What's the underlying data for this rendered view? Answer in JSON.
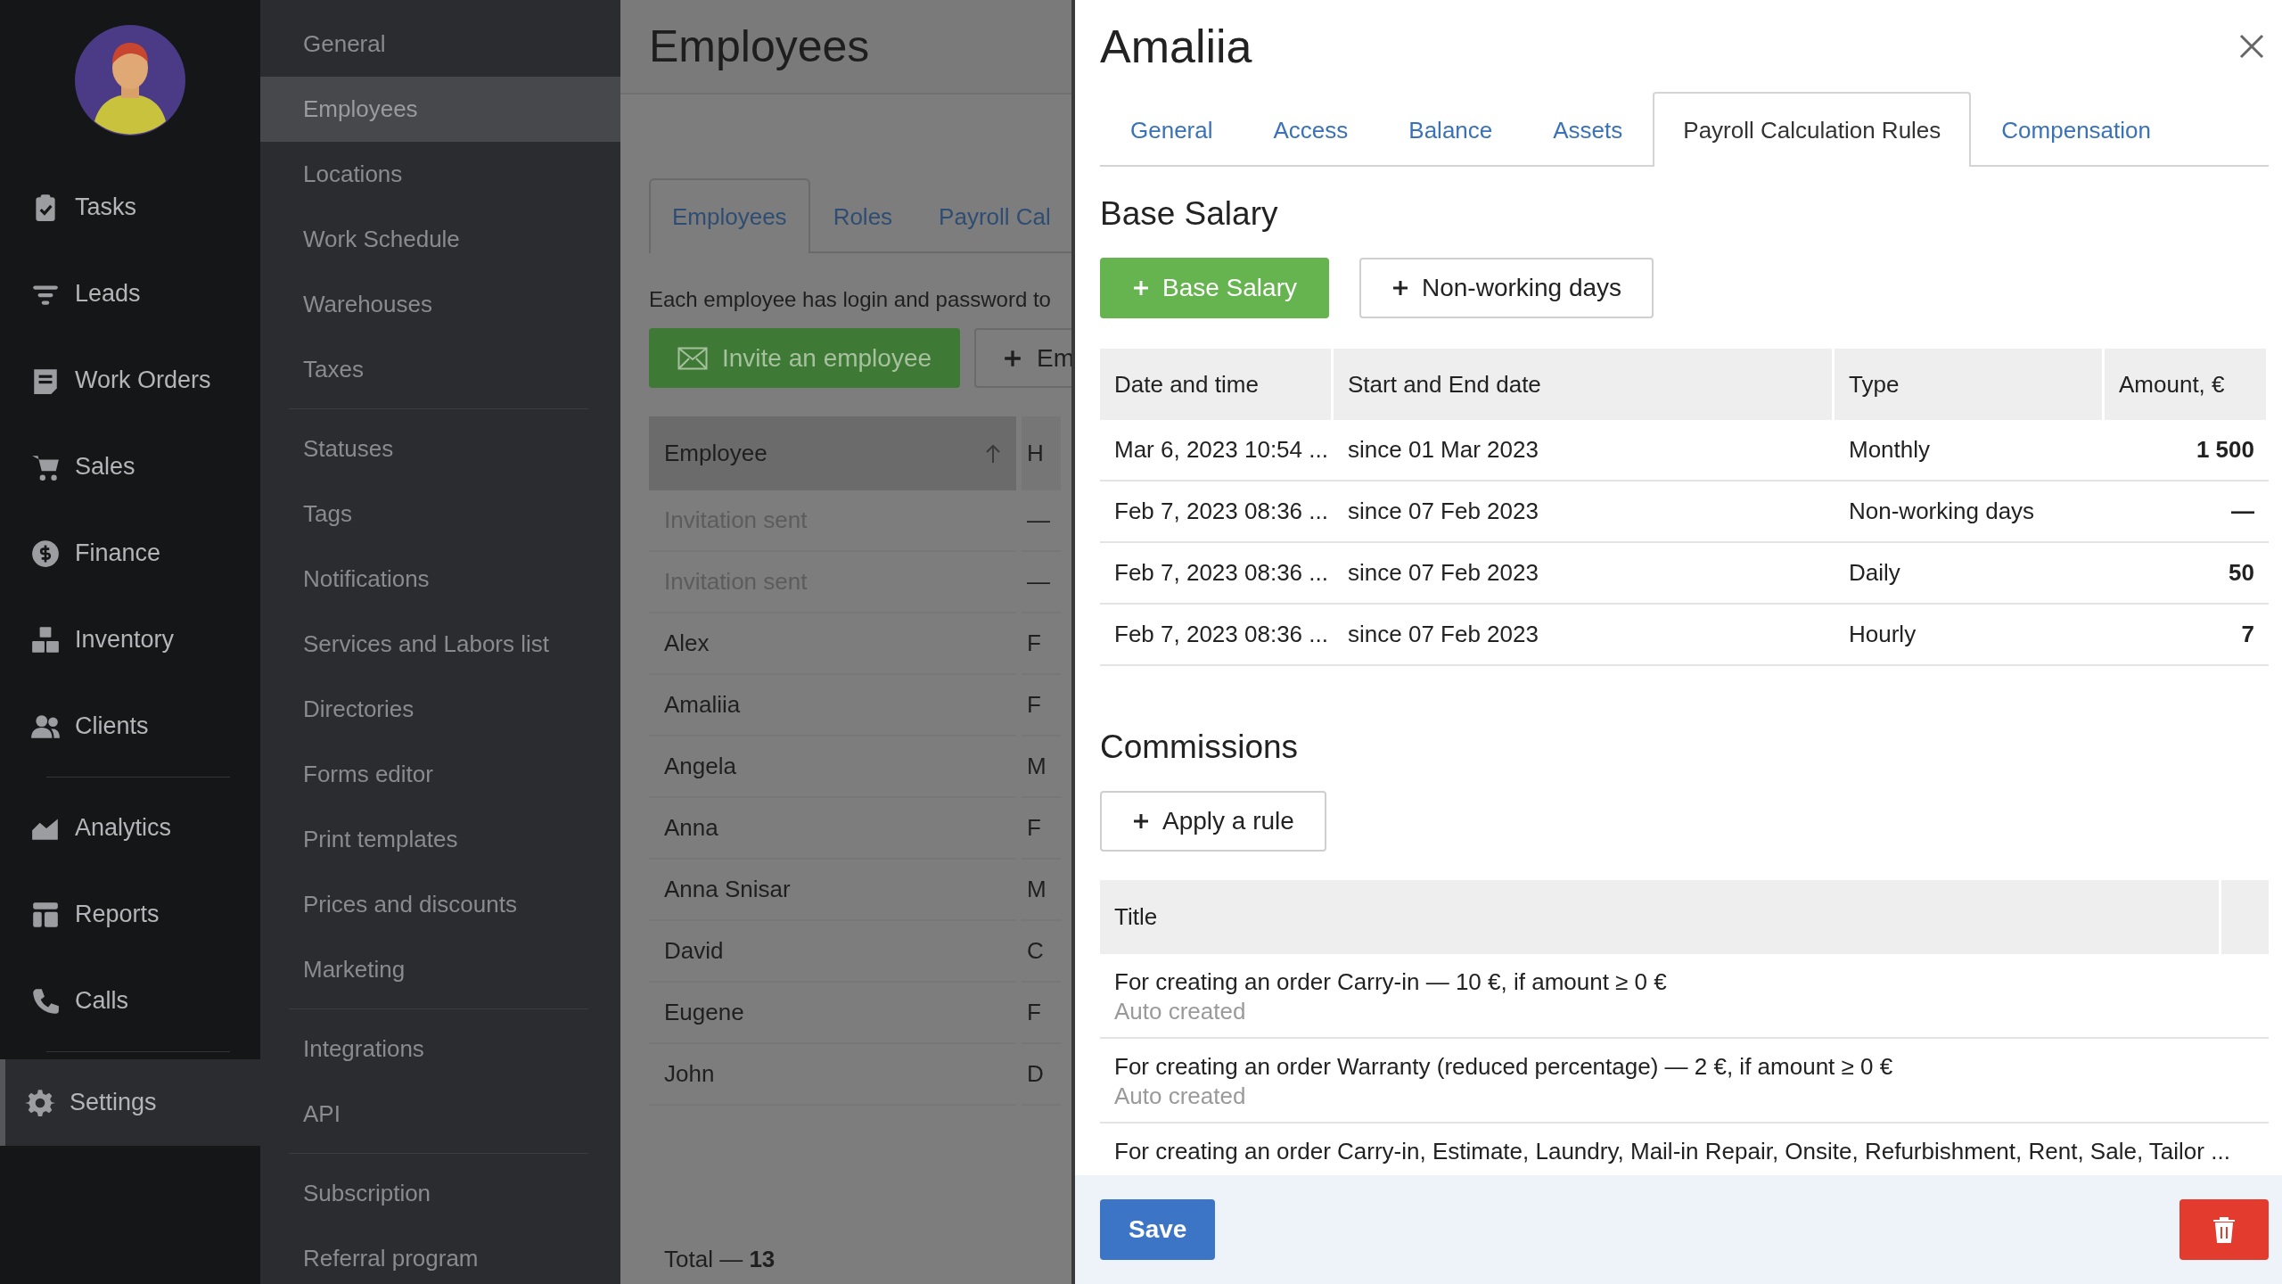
{
  "nav": {
    "groups": [
      {
        "items": [
          {
            "label": "Tasks",
            "selected": false
          },
          {
            "label": "Leads",
            "selected": false
          },
          {
            "label": "Work Orders",
            "selected": false
          },
          {
            "label": "Sales",
            "selected": false
          },
          {
            "label": "Finance",
            "selected": false
          },
          {
            "label": "Inventory",
            "selected": false
          },
          {
            "label": "Clients",
            "selected": false
          }
        ]
      },
      {
        "items": [
          {
            "label": "Analytics",
            "selected": false
          },
          {
            "label": "Reports",
            "selected": false
          },
          {
            "label": "Calls",
            "selected": false
          }
        ]
      },
      {
        "items": [
          {
            "label": "Settings",
            "selected": true
          }
        ]
      }
    ]
  },
  "settings_menu": {
    "groups": [
      {
        "items": [
          {
            "label": "General",
            "selected": false
          },
          {
            "label": "Employees",
            "selected": true
          },
          {
            "label": "Locations",
            "selected": false
          },
          {
            "label": "Work Schedule",
            "selected": false
          },
          {
            "label": "Warehouses",
            "selected": false
          },
          {
            "label": "Taxes",
            "selected": false
          }
        ]
      },
      {
        "items": [
          {
            "label": "Statuses",
            "selected": false
          },
          {
            "label": "Tags",
            "selected": false
          },
          {
            "label": "Notifications",
            "selected": false
          },
          {
            "label": "Services and Labors list",
            "selected": false
          },
          {
            "label": "Directories",
            "selected": false
          },
          {
            "label": "Forms editor",
            "selected": false
          },
          {
            "label": "Print templates",
            "selected": false
          },
          {
            "label": "Prices and discounts",
            "selected": false
          },
          {
            "label": "Marketing",
            "selected": false
          }
        ]
      },
      {
        "items": [
          {
            "label": "Integrations",
            "selected": false
          },
          {
            "label": "API",
            "selected": false
          }
        ]
      },
      {
        "items": [
          {
            "label": "Subscription",
            "selected": false
          },
          {
            "label": "Referral program",
            "selected": false
          }
        ]
      }
    ]
  },
  "employees_page": {
    "title": "Employees",
    "tabs": [
      {
        "label": "Employees",
        "selected": true
      },
      {
        "label": "Roles",
        "selected": false
      },
      {
        "label": "Payroll Cal",
        "selected": false
      }
    ],
    "description": "Each employee has login and password to",
    "buttons": [
      {
        "label": "Invite an employee",
        "kind": "invite"
      },
      {
        "label": "Em",
        "kind": "add"
      }
    ],
    "table": {
      "columns": [
        "Employee",
        "H"
      ],
      "rows": [
        {
          "name": "Invitation sent",
          "column_2": "—",
          "pending": true
        },
        {
          "name": "Invitation sent",
          "column_2": "—",
          "pending": true
        },
        {
          "name": "Alex",
          "column_2": "F",
          "pending": false
        },
        {
          "name": "Amaliia",
          "column_2": "F",
          "pending": false
        },
        {
          "name": "Angela",
          "column_2": "M",
          "pending": false
        },
        {
          "name": "Anna",
          "column_2": "F",
          "pending": false
        },
        {
          "name": "Anna Snisar",
          "column_2": "M",
          "pending": false
        },
        {
          "name": "David",
          "column_2": "C",
          "pending": false
        },
        {
          "name": "Eugene",
          "column_2": "F",
          "pending": false
        },
        {
          "name": "John",
          "column_2": "D",
          "pending": false
        }
      ]
    },
    "total": "Total — **13**"
  },
  "drawer": {
    "title": "Amaliia",
    "tabs": [
      {
        "label": "General",
        "selected": false
      },
      {
        "label": "Access",
        "selected": false
      },
      {
        "label": "Balance",
        "selected": false
      },
      {
        "label": "Assets",
        "selected": false
      },
      {
        "label": "Payroll Calculation Rules",
        "selected": true
      },
      {
        "label": "Compensation",
        "selected": false
      }
    ],
    "base_salary": {
      "heading": "Base Salary",
      "buttons": [
        {
          "label": "Base Salary",
          "kind": "primary"
        },
        {
          "label": "Non-working days",
          "kind": "outline"
        }
      ],
      "table": {
        "columns": [
          "Date and time",
          "Start and End date",
          "Type",
          "Amount, €"
        ],
        "rows": [
          {
            "date_time": "Mar 6, 2023 10:54 ...",
            "period": "since 01 Mar 2023",
            "type": "Monthly",
            "amount": "1 500"
          },
          {
            "date_time": "Feb 7, 2023 08:36 ...",
            "period": "since 07 Feb 2023",
            "type": "Non-working days",
            "amount": "—"
          },
          {
            "date_time": "Feb 7, 2023 08:36 ...",
            "period": "since 07 Feb 2023",
            "type": "Daily",
            "amount": "50"
          },
          {
            "date_time": "Feb 7, 2023 08:36 ...",
            "period": "since 07 Feb 2023",
            "type": "Hourly",
            "amount": "7"
          }
        ]
      }
    },
    "commissions": {
      "heading": "Commissions",
      "button": "Apply a rule",
      "table": {
        "columns": [
          "Title"
        ],
        "rows": [
          {
            "title": "For creating an order Carry-in — 10 €, if amount ≥ 0 €",
            "note": "Auto created"
          },
          {
            "title": "For creating an order Warranty (reduced percentage) — 2 €, if amount ≥ 0 €",
            "note": "Auto created"
          },
          {
            "title": "For creating an order Carry-in, Estimate, Laundry, Mail-in Repair, Onsite, Refurbishment, Rent, Sale, Tailor ..."
          }
        ]
      }
    },
    "footer": {
      "save": "Save"
    }
  }
}
